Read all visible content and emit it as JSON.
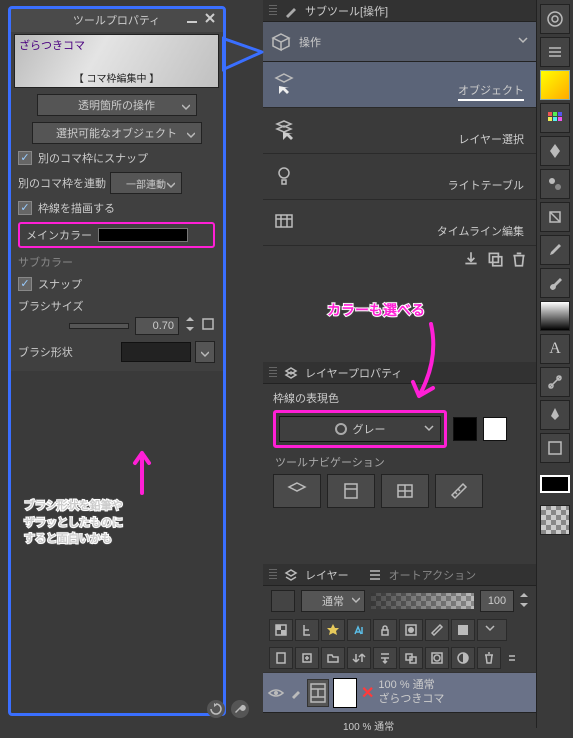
{
  "tool_property": {
    "title": "ツールプロパティ",
    "preset_name": "ざらつきコマ",
    "edit_status": "【 コマ枠編集中 】",
    "transparent_op": "透明箇所の操作",
    "selectable": "選択可能なオブジェクト",
    "snap_frame_label": "別のコマ枠にスナップ",
    "link_frame_label": "別のコマ枠を連動",
    "link_frame_mode": "一部連動",
    "draw_border_label": "枠線を描画する",
    "main_color_label": "メインカラー",
    "sub_color_label": "サブカラー",
    "snap_label": "スナップ",
    "brush_size_label": "ブラシサイズ",
    "brush_size_value": "0.70",
    "brush_shape_label": "ブラシ形状"
  },
  "subtool": {
    "header": "サブツール[操作]",
    "group": "操作",
    "items": [
      {
        "label": "オブジェクト"
      },
      {
        "label": "レイヤー選択"
      },
      {
        "label": "ライトテーブル"
      },
      {
        "label": "タイムライン編集"
      }
    ]
  },
  "layer_property": {
    "header": "レイヤープロパティ",
    "expr_label": "枠線の表現色",
    "expr_mode": "グレー"
  },
  "tool_nav_label": "ツールナビゲーション",
  "layers": {
    "header": "レイヤー",
    "auto_action": "オートアクション",
    "blend_mode": "通常",
    "opacity": "100",
    "row1_top": "100 % 通常",
    "row1_name": "ざらつきコマ",
    "row2_top": "100 % 通常"
  },
  "annotations": {
    "color_pick": "カラーも選べる",
    "brush_hint_l1": "ブラシ形状を鉛筆や",
    "brush_hint_l2": "ザラッとしたものに",
    "brush_hint_l3": "すると面白いかも"
  }
}
